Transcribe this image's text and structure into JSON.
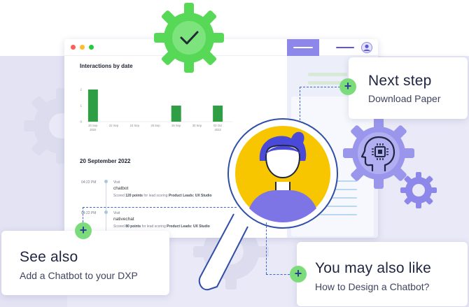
{
  "window": {
    "chart_heading": "Interactions by date",
    "chart_data": {
      "type": "bar",
      "title": "Interactions by date",
      "categories": [
        "20 Sep 2022",
        "22 Sep",
        "24 Sep",
        "26 Sep",
        "28 Sep",
        "30 Sep",
        "02 Oct 2022"
      ],
      "values": [
        2,
        0,
        0,
        0,
        1,
        0,
        1
      ],
      "ylim": [
        0,
        2
      ],
      "yticks": [
        "0",
        "1",
        "2"
      ],
      "bar_color": "#2f9e44"
    },
    "date_heading": "20 September 2022",
    "timeline": [
      {
        "time": "04:22 PM",
        "type": "Visit",
        "name": "chatbot",
        "detail_pre": "Scored ",
        "points": "120 points",
        "detail_mid": " for lead scoring ",
        "target": "Product Leads: UX Studio"
      },
      {
        "time": "04:22 PM",
        "type": "Visit",
        "name": "nativechat",
        "detail_pre": "Scored ",
        "points": "80 points",
        "detail_mid": " for lead scoring ",
        "target": "Product Leads: UX Studio"
      }
    ]
  },
  "cards": {
    "next_step": {
      "title": "Next step",
      "subtitle": "Download Paper"
    },
    "see_also": {
      "title": "See also",
      "subtitle": "Add a Chatbot to your DXP"
    },
    "may_like": {
      "title": "You may also like",
      "subtitle": "How to Design a Chatbot?"
    }
  },
  "icons": {
    "check_gear": "check-gear-icon",
    "ai_head_gear": "ai-head-gear-icon",
    "magnifier": "magnifier-icon",
    "avatar": "user-avatar-icon",
    "plus": "plus-icon"
  },
  "colors": {
    "accent_purple": "#8e87ea",
    "accent_green": "#57d957",
    "plus_green": "#7cdc7c",
    "avatar_yellow": "#f7c600",
    "avatar_hair": "#4b49d8",
    "dash_blue": "#3a66d6"
  }
}
